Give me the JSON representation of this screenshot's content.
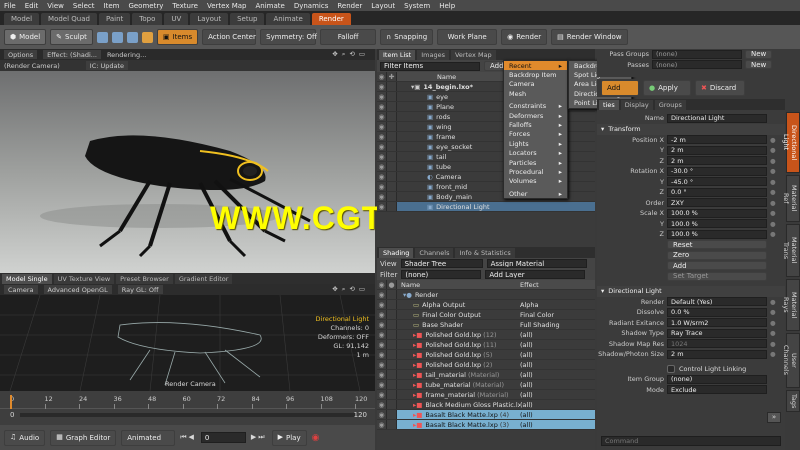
{
  "menubar": [
    "File",
    "Edit",
    "View",
    "Select",
    "Item",
    "Geometry",
    "Texture",
    "Vertex Map",
    "Animate",
    "Dynamics",
    "Render",
    "Layout",
    "System",
    "Help"
  ],
  "layout_tabs": [
    "Model",
    "Model Quad",
    "Paint",
    "Topo",
    "UV",
    "Layout",
    "Setup",
    "Animate",
    "Render"
  ],
  "active_layout_tab": "Render",
  "toolbar": {
    "model": "Model",
    "sculpt": "Sculpt",
    "items": "Items",
    "action_center": "Action Center",
    "symmetry": "Symmetry: Off",
    "falloff": "Falloff",
    "snapping": "Snapping",
    "work_plane": "Work Plane",
    "render": "Render",
    "render_window": "Render Window"
  },
  "viewport": {
    "options": "Options",
    "effect": "Effect: (Shadi...",
    "rendering": "Rendering...",
    "camera": "(Render Camera)",
    "ic": "IC: Update"
  },
  "watermark": "WWW.CGTSJ.COM",
  "lower_tabs": [
    "Model Single",
    "UV Texture View",
    "Preset Browser",
    "Gradient Editor"
  ],
  "lower_viewport": {
    "camera": "Camera",
    "opengl": "Advanced OpenGL",
    "raygl": "Ray GL: Off",
    "light": "Directional Light",
    "channels": "Channels: 0",
    "deformers": "Deformers: OFF",
    "gl": "GL: 91,142",
    "unit": "1 m",
    "label": "Render Camera"
  },
  "timeline": {
    "ticks": [
      "0",
      "12",
      "24",
      "36",
      "48",
      "60",
      "72",
      "84",
      "96",
      "108",
      "120"
    ],
    "start": "0",
    "end": "120",
    "frame": "0"
  },
  "bottombar": {
    "audio": "Audio",
    "graph_editor": "Graph Editor",
    "animated": "Animated",
    "frame": "0",
    "play": "Play"
  },
  "item_list": {
    "tabs": [
      "Item List",
      "Images",
      "Vertex Map"
    ],
    "filter": "Filter Items",
    "add": "Add I",
    "col_name": "Name",
    "items": [
      {
        "label": "14_begin.lxo*",
        "indent": 0
      },
      {
        "label": "eye",
        "indent": 2
      },
      {
        "label": "Plane",
        "indent": 2
      },
      {
        "label": "rods",
        "indent": 2
      },
      {
        "label": "wing",
        "indent": 2
      },
      {
        "label": "frame",
        "indent": 2
      },
      {
        "label": "eye_socket",
        "indent": 2
      },
      {
        "label": "tail",
        "indent": 2
      },
      {
        "label": "tube",
        "indent": 2
      },
      {
        "label": "Camera",
        "indent": 2
      },
      {
        "label": "front_mid",
        "indent": 2
      },
      {
        "label": "Body_main",
        "indent": 2
      },
      {
        "label": "Directional Light",
        "indent": 2
      }
    ]
  },
  "add_menu": {
    "items": [
      "Recent",
      "Backdrop Item",
      "Camera",
      "Mesh",
      "Constraints",
      "Deformers",
      "Falloffs",
      "Forces",
      "Lights",
      "Locators",
      "Particles",
      "Procedural",
      "Volumes",
      "Other"
    ],
    "arrows": [
      true,
      false,
      false,
      false,
      true,
      true,
      true,
      true,
      true,
      true,
      true,
      true,
      true,
      true
    ],
    "highlighted": "Recent"
  },
  "sub_menu": {
    "items": [
      "Backdrop Item",
      "Spot Light",
      "Area Light",
      "Directional Light",
      "Point Light"
    ]
  },
  "pass_groups": {
    "label1": "Pass Groups",
    "val1": "(none)",
    "new1": "New",
    "label2": "Passes",
    "val2": "(none)",
    "new2": "New"
  },
  "actions": {
    "add": "Add",
    "apply": "Apply",
    "discard": "Discard"
  },
  "props_tabs": [
    "ties",
    "Display",
    "Groups"
  ],
  "properties": {
    "name_label": "Name",
    "name_value": "Directional Light",
    "transform": "Transform",
    "position": [
      {
        "axis": "Position X",
        "val": "-2 m"
      },
      {
        "axis": "Y",
        "val": "2 m"
      },
      {
        "axis": "Z",
        "val": "2 m"
      }
    ],
    "rotation": [
      {
        "axis": "Rotation X",
        "val": "-30.0 °"
      },
      {
        "axis": "Y",
        "val": "-45.0 °"
      },
      {
        "axis": "Z",
        "val": "0.0 °"
      }
    ],
    "order_label": "Order",
    "order_val": "ZXY",
    "scale": [
      {
        "axis": "Scale X",
        "val": "100.0 %"
      },
      {
        "axis": "Y",
        "val": "100.0 %"
      },
      {
        "axis": "Z",
        "val": "100.0 %"
      }
    ],
    "reset": "Reset",
    "zero": "Zero",
    "add": "Add",
    "set_target": "Set Target",
    "dl_section": "Directional Light",
    "fields": [
      {
        "label": "Render",
        "val": "Default (Yes)"
      },
      {
        "label": "Dissolve",
        "val": "0.0 %"
      },
      {
        "label": "Radiant Exitance",
        "val": "1.0 W/srm2"
      },
      {
        "label": "Shadow Type",
        "val": "Ray Trace"
      },
      {
        "label": "Shadow Map Res",
        "val": "1024"
      },
      {
        "label": "Shadow/Photon Size",
        "val": "2 m"
      }
    ],
    "control_linking": "Control Light Linking",
    "item_group_label": "Item Group",
    "item_group_val": "(none)",
    "mode_label": "Mode",
    "mode_val": "Exclude",
    "command": "Command"
  },
  "vtabs": [
    "Directional Light",
    "Material Ref",
    "Material Trans",
    "Material Rays",
    "User Channels",
    "Tags"
  ],
  "shading": {
    "tabs": [
      "Shading",
      "Channels",
      "Info & Statistics"
    ],
    "view_label": "View",
    "view_val": "Shader Tree",
    "assign": "Assign Material",
    "filter_label": "Filter",
    "filter_val": "(none)",
    "add_layer": "Add Layer",
    "col_name": "Name",
    "col_effect": "Effect",
    "rows": [
      {
        "name": "Render",
        "sub": "",
        "effect": "",
        "indent": 0
      },
      {
        "name": "Alpha Output",
        "sub": "",
        "effect": "Alpha",
        "indent": 1
      },
      {
        "name": "Final Color Output",
        "sub": "",
        "effect": "Final Color",
        "indent": 1
      },
      {
        "name": "Base Shader",
        "sub": "",
        "effect": "Full Shading",
        "indent": 1
      },
      {
        "name": "Polished Gold.lxp",
        "sub": "(12)",
        "effect": "(all)",
        "indent": 1
      },
      {
        "name": "Polished Gold.lxp",
        "sub": "(11)",
        "effect": "(all)",
        "indent": 1
      },
      {
        "name": "Polished Gold.lxp",
        "sub": "(5)",
        "effect": "(all)",
        "indent": 1
      },
      {
        "name": "Polished Gold.lxp",
        "sub": "(2)",
        "effect": "(all)",
        "indent": 1
      },
      {
        "name": "tail_material",
        "sub": "(Material)",
        "effect": "(all)",
        "indent": 1
      },
      {
        "name": "tube_material",
        "sub": "(Material)",
        "effect": "(all)",
        "indent": 1
      },
      {
        "name": "frame_material",
        "sub": "(Material)",
        "effect": "(all)",
        "indent": 1
      },
      {
        "name": "Black Medium Gloss Plastic.lxp",
        "sub": "",
        "effect": "(all)",
        "indent": 1
      },
      {
        "name": "Basalt Black Matte.lxp",
        "sub": "(4)",
        "effect": "(all)",
        "indent": 1
      },
      {
        "name": "Basalt Black Matte.lxp",
        "sub": "(3)",
        "effect": "(all)",
        "indent": 1
      }
    ]
  },
  "colors": {
    "accent": "#c8541a",
    "highlight": "#e08a2c",
    "selected_row": "#4a7fa8",
    "gold": "#f0c020"
  }
}
